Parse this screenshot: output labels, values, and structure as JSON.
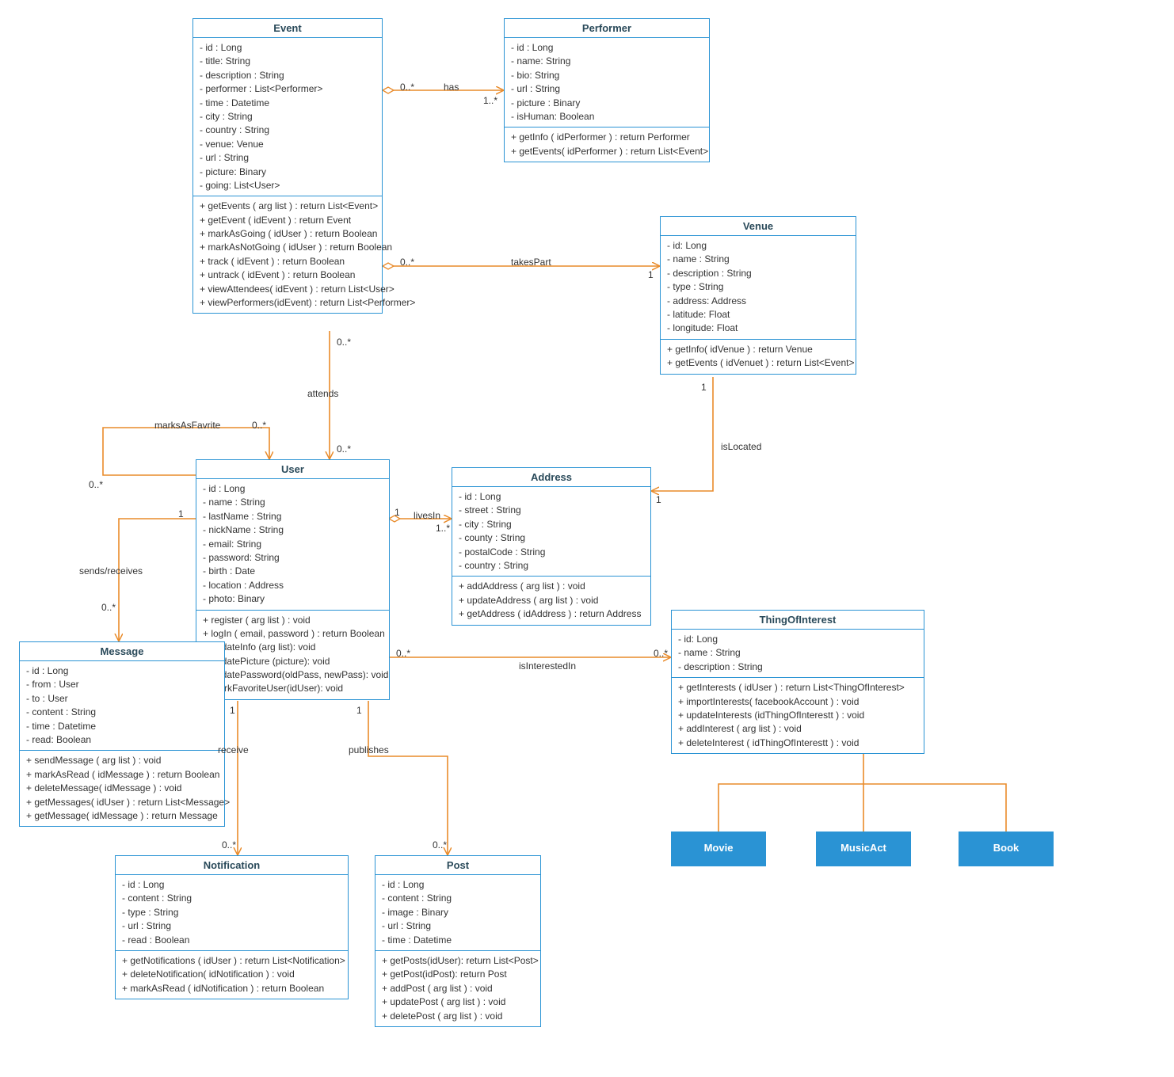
{
  "classes": {
    "Event": {
      "title": "Event",
      "attrs": [
        "- id : Long",
        "- title: String",
        "- description : String",
        "- performer : List<Performer>",
        "- time : Datetime",
        "- city : String",
        "- country : String",
        "- venue: Venue",
        "- url : String",
        "- picture: Binary",
        "- going: List<User>"
      ],
      "ops": [
        "+ getEvents ( arg list ) : return List<Event>",
        "+ getEvent ( idEvent ) : return Event",
        "+ markAsGoing ( idUser ) : return Boolean",
        "+ markAsNotGoing ( idUser ) : return Boolean",
        "+ track ( idEvent ) : return Boolean",
        "+ untrack ( idEvent ) : return Boolean",
        "+ viewAttendees( idEvent ) : return List<User>",
        "+ viewPerformers(idEvent) : return List<Performer>"
      ]
    },
    "Performer": {
      "title": "Performer",
      "attrs": [
        "- id : Long",
        "- name: String",
        "- bio: String",
        "- url : String",
        "- picture : Binary",
        "- isHuman: Boolean"
      ],
      "ops": [
        "+ getInfo ( idPerformer ) : return Performer",
        "+ getEvents( idPerformer ) : return List<Event>"
      ]
    },
    "Venue": {
      "title": "Venue",
      "attrs": [
        "- id: Long",
        "- name : String",
        "- description : String",
        "- type : String",
        "- address: Address",
        "- latitude: Float",
        "- longitude: Float"
      ],
      "ops": [
        "+ getInfo( idVenue ) : return Venue",
        "+ getEvents ( idVenuet ) : return List<Event>"
      ]
    },
    "User": {
      "title": "User",
      "attrs": [
        "- id : Long",
        "- name : String",
        "- lastName : String",
        "- nickName : String",
        "- email: String",
        "- password: String",
        "- birth : Date",
        "- location : Address",
        "- photo: Binary"
      ],
      "ops": [
        "+ register ( arg list ) : void",
        "+ logIn ( email, password ) : return Boolean",
        "+ updateInfo (arg list): void",
        "+ updatePicture (picture): void",
        "+ updatePassword(oldPass, newPass): void",
        "+ markFavoriteUser(idUser): void"
      ]
    },
    "Address": {
      "title": "Address",
      "attrs": [
        "- id : Long",
        "- street : String",
        "- city : String",
        "- county : String",
        "- postalCode : String",
        "- country : String"
      ],
      "ops": [
        "+ addAddress ( arg list ) : void",
        "+ updateAddress ( arg list ) : void",
        "+ getAddress ( idAddress ) : return Address"
      ]
    },
    "ThingOfInterest": {
      "title": "ThingOfInterest",
      "attrs": [
        "- id: Long",
        "- name : String",
        "- description : String"
      ],
      "ops": [
        "+ getInterests ( idUser ) : return List<ThingOfInterest>",
        "+ importInterests( facebookAccount ) : void",
        "+ updateInterests (idThingOfInterestt ) : void",
        "+ addInterest ( arg list ) : void",
        "+ deleteInterest ( idThingOfInterestt ) : void"
      ]
    },
    "Message": {
      "title": "Message",
      "attrs": [
        "- id : Long",
        "- from : User",
        "- to : User",
        "- content : String",
        "- time : Datetime",
        "- read: Boolean"
      ],
      "ops": [
        "+ sendMessage ( arg list ) : void",
        "+ markAsRead ( idMessage ) : return Boolean",
        "+ deleteMessage( idMessage ) : void",
        "+ getMessages( idUser ) : return List<Message>",
        "+ getMessage( idMessage ) : return Message"
      ]
    },
    "Notification": {
      "title": "Notification",
      "attrs": [
        "- id : Long",
        "- content : String",
        "- type : String",
        "- url : String",
        "- read : Boolean"
      ],
      "ops": [
        "+ getNotifications ( idUser ) : return List<Notification>",
        "+ deleteNotification( idNotification ) : void",
        "+ markAsRead ( idNotification ) : return Boolean"
      ]
    },
    "Post": {
      "title": "Post",
      "attrs": [
        "- id : Long",
        "- content : String",
        "- image : Binary",
        "- url : String",
        "- time : Datetime"
      ],
      "ops": [
        "+ getPosts(idUser): return List<Post>",
        "+ getPost(idPost): return Post",
        "+ addPost ( arg list ) : void",
        "+ updatePost ( arg list ) : void",
        "+ deletePost ( arg list ) : void"
      ]
    },
    "Movie": {
      "title": "Movie"
    },
    "MusicAct": {
      "title": "MusicAct"
    },
    "Book": {
      "title": "Book"
    }
  },
  "labels": {
    "has": "has",
    "takesPart": "takesPart",
    "attends": "attends",
    "marksAsFavrite": "marksAsFavrite",
    "sendsReceives": "sends/receives",
    "livesIn": "livesIn",
    "isLocated": "isLocated",
    "isInterestedIn": "isInterestedIn",
    "receive": "receive",
    "publishes": "publishes",
    "m0s": "0..*",
    "m1s": "1..*",
    "m1": "1"
  }
}
